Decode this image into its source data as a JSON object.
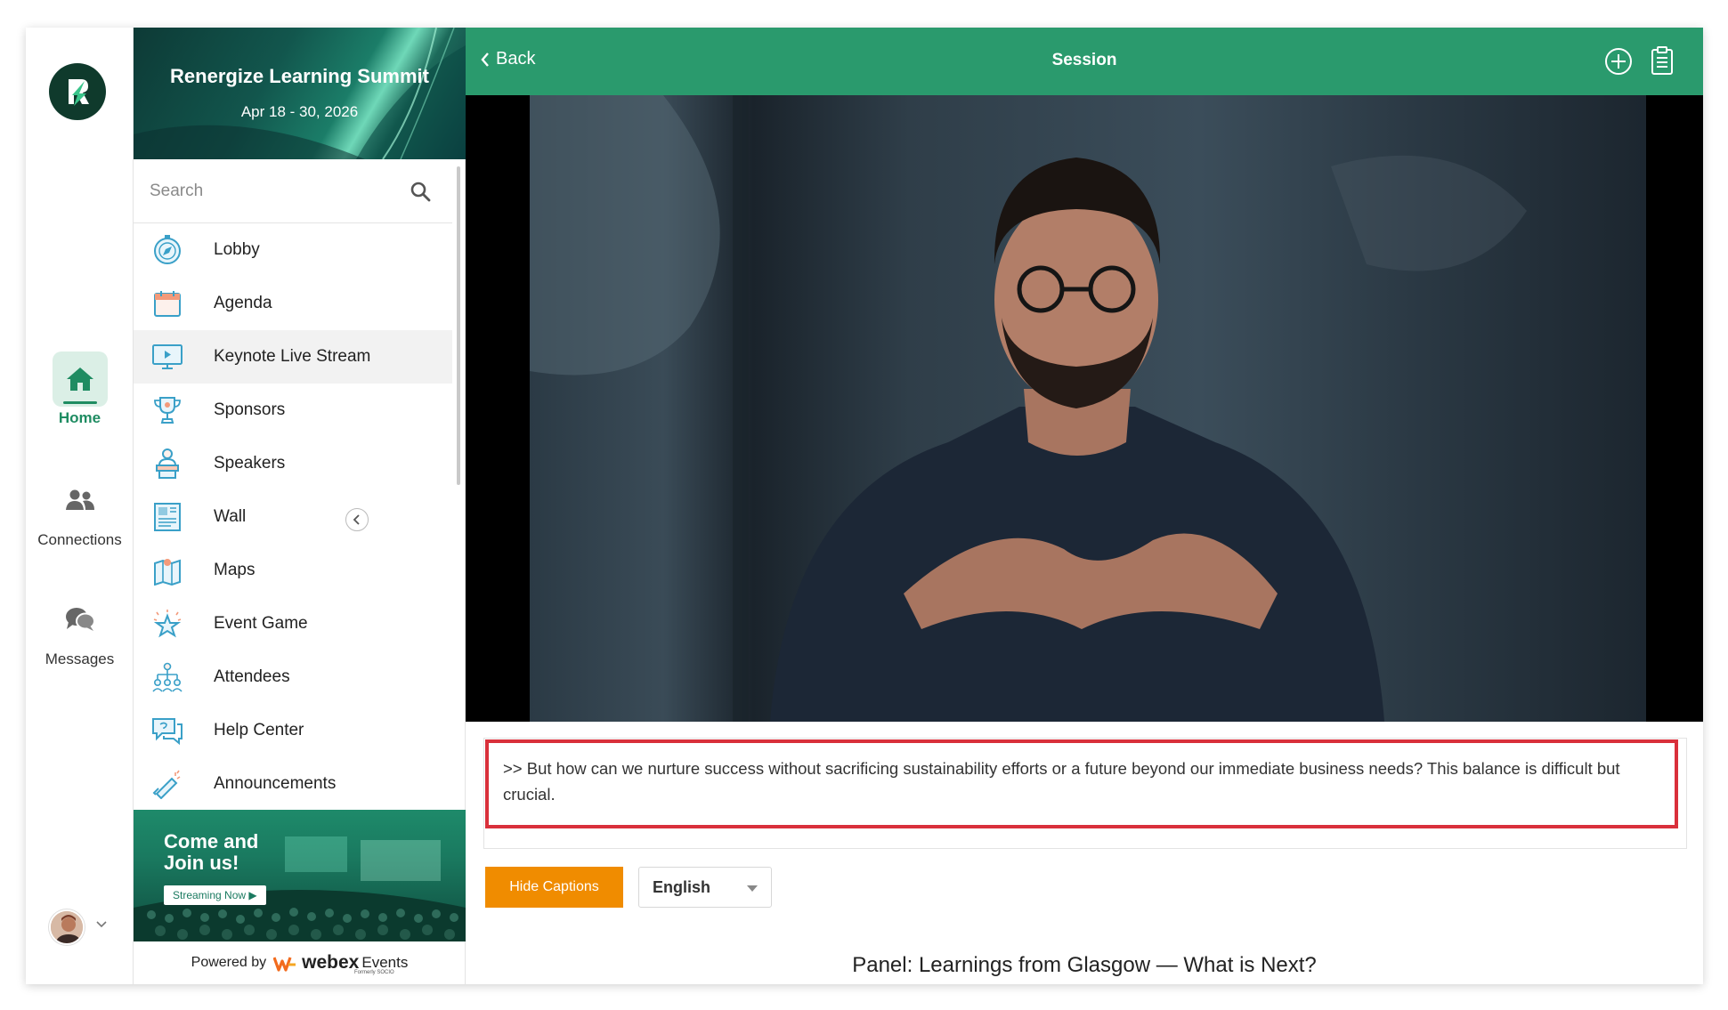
{
  "event": {
    "title": "Renergize Learning Summit",
    "dates": "Apr 18 - 30, 2026"
  },
  "rail": {
    "items": [
      {
        "label": "Home",
        "icon": "home-icon",
        "active": true
      },
      {
        "label": "Connections",
        "icon": "people-icon",
        "active": false
      },
      {
        "label": "Messages",
        "icon": "chat-bubbles-icon",
        "active": false
      }
    ]
  },
  "search": {
    "placeholder": "Search"
  },
  "menu": {
    "items": [
      {
        "label": "Lobby",
        "icon": "compass-icon"
      },
      {
        "label": "Agenda",
        "icon": "calendar-icon"
      },
      {
        "label": "Keynote Live Stream",
        "icon": "monitor-play-icon",
        "active": true
      },
      {
        "label": "Sponsors",
        "icon": "trophy-icon"
      },
      {
        "label": "Speakers",
        "icon": "podium-speaker-icon"
      },
      {
        "label": "Wall",
        "icon": "newspaper-icon"
      },
      {
        "label": "Maps",
        "icon": "map-icon"
      },
      {
        "label": "Event Game",
        "icon": "star-icon"
      },
      {
        "label": "Attendees",
        "icon": "org-chart-icon"
      },
      {
        "label": "Help Center",
        "icon": "chat-help-icon"
      },
      {
        "label": "Announcements",
        "icon": "megaphone-icon"
      }
    ]
  },
  "promo": {
    "title": "Come and Join us!",
    "button": "Streaming Now ▶"
  },
  "footer": {
    "powered_by": "Powered by",
    "brand": "webex",
    "brand_suffix": "Events",
    "formerly": "Formerly SOCIO"
  },
  "topbar": {
    "back_label": "Back",
    "title": "Session"
  },
  "captions": {
    "text": ">> But how can we nurture success without sacrificing sustainability efforts or a future beyond our immediate business needs? This balance is difficult but crucial.",
    "hide_button": "Hide Captions",
    "language": "English"
  },
  "session": {
    "title": "Panel: Learnings from Glasgow — What is Next?"
  },
  "colors": {
    "brand_green": "#2a9a6d",
    "accent_orange": "#f08c00",
    "caption_border": "#d9303b"
  }
}
